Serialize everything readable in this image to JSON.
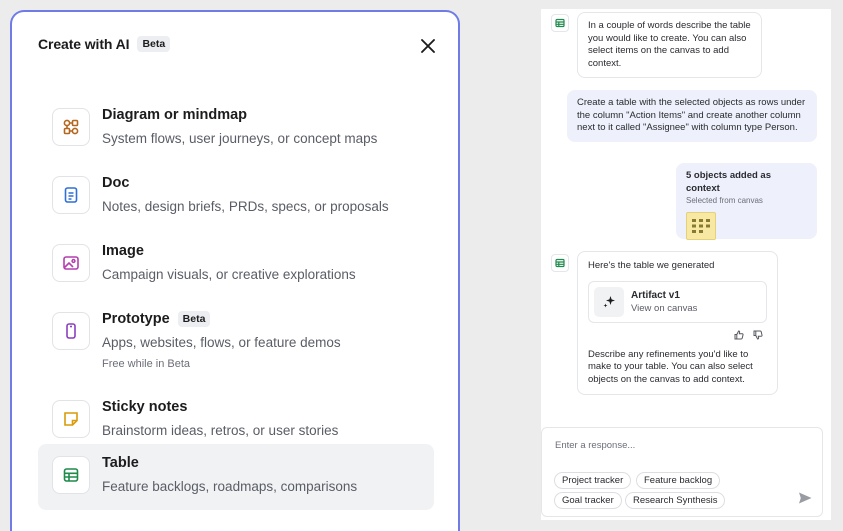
{
  "left": {
    "title": "Create with AI",
    "beta": "Beta",
    "options": [
      {
        "title": "Diagram or mindmap",
        "desc": "System flows, user journeys, or concept maps"
      },
      {
        "title": "Doc",
        "desc": "Notes, design briefs, PRDs, specs, or proposals"
      },
      {
        "title": "Image",
        "desc": "Campaign visuals, or creative explorations"
      },
      {
        "title": "Prototype",
        "badge": "Beta",
        "desc": "Apps, websites, flows, or feature demos",
        "note": "Free while in Beta"
      },
      {
        "title": "Sticky notes",
        "desc": "Brainstorm ideas, retros, or user stories"
      },
      {
        "title": "Table",
        "desc": "Feature backlogs, roadmaps, comparisons"
      }
    ]
  },
  "right": {
    "bot_msg_1": "In a couple of words describe the table you would like to create. You can also select items on the canvas to add context.",
    "user_msg": "Create a table with the selected objects as rows under the column \"Action Items\" and create another column next to it called \"Assignee\" with column type Person.",
    "context_title": "5 objects added as context",
    "context_sub": "Selected from canvas",
    "bot_msg_2_intro": "Here's the table we generated",
    "artifact_title": "Artifact v1",
    "artifact_link": "View on canvas",
    "bot_msg_2_outro": "Describe any refinements you'd like to make to your table. You can also select objects on the canvas to add context.",
    "composer_placeholder": "Enter a response...",
    "chips": [
      "Project tracker",
      "Feature backlog",
      "Goal tracker",
      "Research Synthesis"
    ]
  },
  "colors": {
    "accent_border": "#6f7ce8",
    "diagram": "#b4661f",
    "doc": "#2f6fd6",
    "image": "#b43fae",
    "prototype": "#8a3fbf",
    "sticky": "#d99a0b",
    "table": "#1e8a4c",
    "user_bubble": "#eef0fb"
  }
}
